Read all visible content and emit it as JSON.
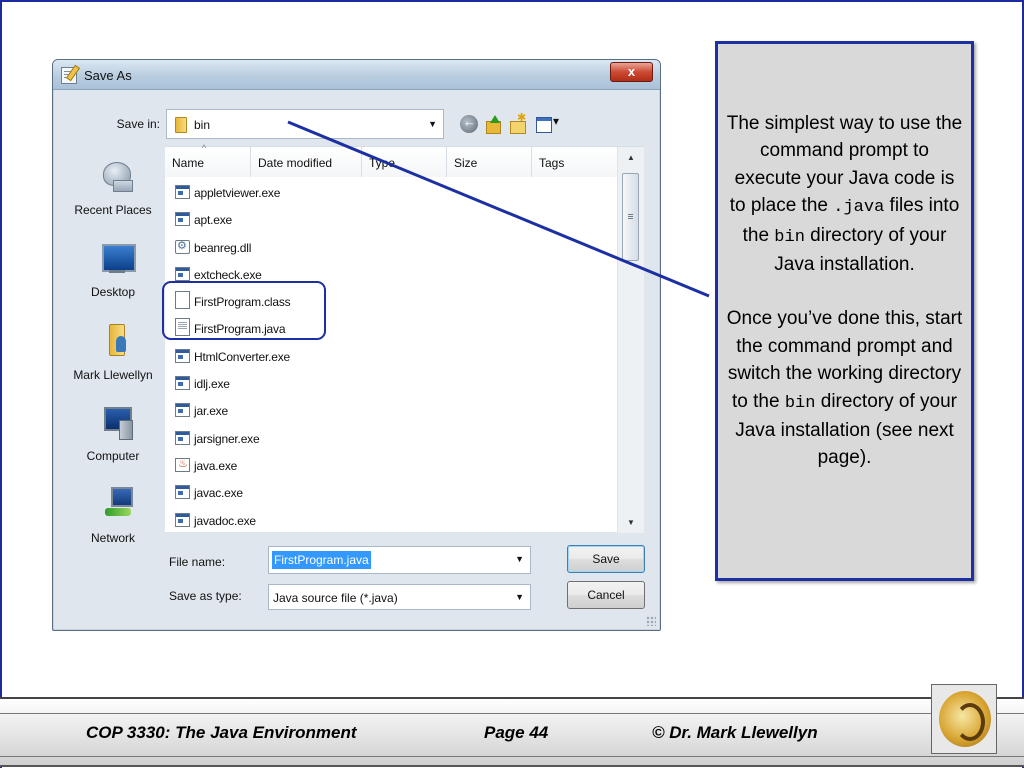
{
  "dialog": {
    "title": "Save As",
    "close_glyph": "x",
    "save_in_label": "Save in:",
    "location": "bin",
    "columns": [
      "Name",
      "Date modified",
      "Type",
      "Size",
      "Tags"
    ],
    "files": [
      {
        "name": "appletviewer.exe",
        "icon": "exe-icon"
      },
      {
        "name": "apt.exe",
        "icon": "exe-icon"
      },
      {
        "name": "beanreg.dll",
        "icon": "dll-icon"
      },
      {
        "name": "extcheck.exe",
        "icon": "exe-icon"
      },
      {
        "name": "FirstProgram.class",
        "icon": "blank-file-icon"
      },
      {
        "name": "FirstProgram.java",
        "icon": "text-file-icon"
      },
      {
        "name": "HtmlConverter.exe",
        "icon": "exe-icon"
      },
      {
        "name": "idlj.exe",
        "icon": "exe-icon"
      },
      {
        "name": "jar.exe",
        "icon": "exe-icon"
      },
      {
        "name": "jarsigner.exe",
        "icon": "exe-icon"
      },
      {
        "name": "java.exe",
        "icon": "java-icon"
      },
      {
        "name": "javac.exe",
        "icon": "exe-icon"
      },
      {
        "name": "javadoc.exe",
        "icon": "exe-icon"
      }
    ],
    "places": [
      {
        "label": "Recent Places",
        "icon": "recent-places-icon"
      },
      {
        "label": "Desktop",
        "icon": "desktop-icon"
      },
      {
        "label": "Mark Llewellyn",
        "icon": "user-folder-icon"
      },
      {
        "label": "Computer",
        "icon": "computer-icon"
      },
      {
        "label": "Network",
        "icon": "network-icon"
      }
    ],
    "file_name_label": "File name:",
    "file_name_value": "FirstProgram.java",
    "save_as_type_label": "Save as type:",
    "save_as_type_value": "Java source file (*.java)",
    "save_button": "Save",
    "cancel_button": "Cancel"
  },
  "callout": {
    "p1": {
      "t1": "The simplest way to use the command prompt to execute your Java code is to place the ",
      "code1": ".java",
      "t2": " files into the ",
      "code2": "bin",
      "t3": " directory of your Java installation."
    },
    "p2": {
      "t1": "Once you’ve done this, start the command prompt and switch the working directory to the ",
      "code1": "bin",
      "t2": " directory of your Java installation (see next page)."
    }
  },
  "footer": {
    "course": "COP 3330:  The Java Environment",
    "page": "Page 44",
    "copyright": "© Dr. Mark Llewellyn"
  },
  "colors": {
    "accent_blue": "#1c2fa3",
    "callout_bg": "#d9d9d9",
    "selection": "#3399ff"
  }
}
